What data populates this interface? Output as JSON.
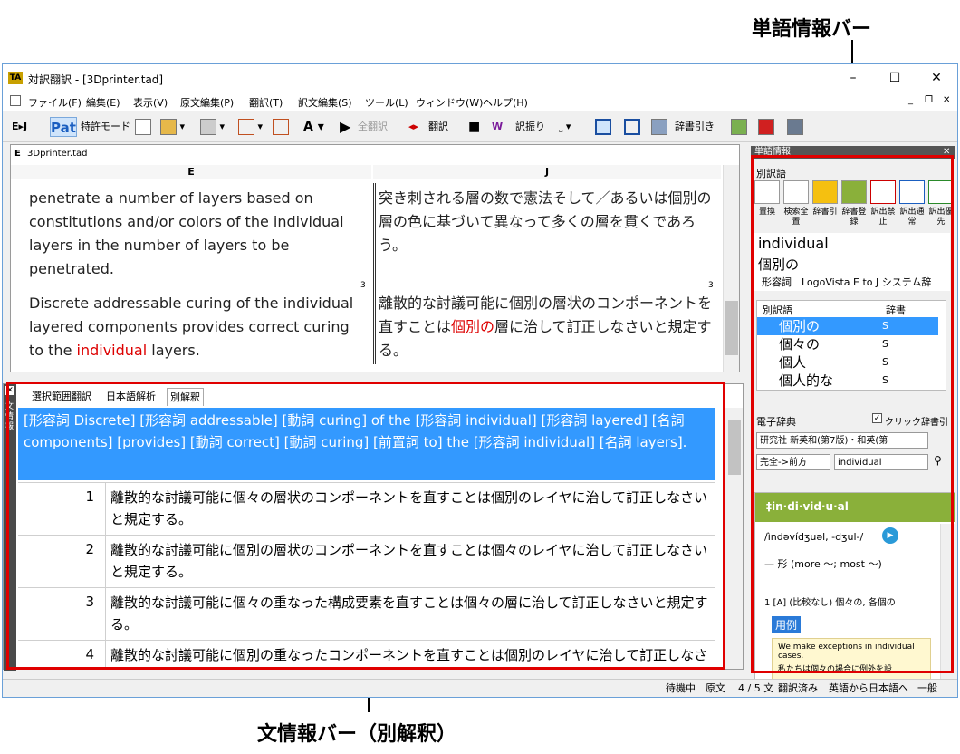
{
  "annotations": {
    "word_info_bar": "単語情報バー",
    "sentence_info_bar": "文情報バー（別解釈）"
  },
  "window": {
    "title": "対訳翻訳 - [3Dprinter.tad]",
    "minimize": "–",
    "maximize": "☐",
    "close": "✕"
  },
  "menu": [
    "ファイル(F)",
    "編集(E)",
    "表示(V)",
    "原文編集(P)",
    "翻訳(T)",
    "訳文編集(S)",
    "ツール(L)",
    "ウィンドウ(W)",
    "ヘルプ(H)"
  ],
  "toolbar": {
    "ej": "E▸J",
    "pat": "Pat",
    "patent_mode": "特許モード",
    "translate_all": "全翻訳",
    "translate": "翻訳",
    "assign": "訳振り",
    "dict_lookup": "辞書引き"
  },
  "document": {
    "tab": "3Dprinter.tad",
    "tab_prefix": "E",
    "col_e": "E",
    "col_j": "J",
    "row1_en": "penetrate a number of layers based on constitutions and/or colors of the individual layers in the number of layers to be penetrated.",
    "row1_ja": "突き刺される層の数で憲法そして／あるいは個別の層の色に基づいて異なって多くの層を貫くであろう。",
    "row_marker": "3",
    "row2_en_a": "Discrete addressable curing of the individual layered components provides correct curing to the ",
    "row2_en_red": "individual",
    "row2_en_b": " layers.",
    "row2_ja_a": "離散的な討議可能に個別の層状のコンポーネントを直すことは",
    "row2_ja_red": "個別の",
    "row2_ja_b": "層に治して訂正しなさいと規定する。"
  },
  "info_panel": {
    "sidebar_label": "文情報",
    "tabs": [
      "選択範囲翻訳",
      "日本語解析",
      "別解釈"
    ],
    "analysis": "[形容詞 Discrete] [形容詞 addressable] [動詞 curing] of the [形容詞 individual] [形容詞 layered] [名詞 components] [provides] [動詞 correct] [動詞 curing] [前置詞 to] the [形容詞 individual] [名詞 layers].",
    "rows": [
      {
        "num": "1",
        "text": "離散的な討議可能に個々の層状のコンポーネントを直すことは個別のレイヤに治して訂正しなさいと規定する。"
      },
      {
        "num": "2",
        "text": "離散的な討議可能に個別の層状のコンポーネントを直すことは個々のレイヤに治して訂正しなさいと規定する。"
      },
      {
        "num": "3",
        "text": "離散的な討議可能に個々の重なった構成要素を直すことは個々の層に治して訂正しなさいと規定する。"
      },
      {
        "num": "4",
        "text": "離散的な討議可能に個別の重なったコンポーネントを直すことは個別のレイヤに治して訂正しなさいと規定する。"
      }
    ]
  },
  "word_panel": {
    "title": "単語情報",
    "section": "別訳語",
    "buttons": [
      "置換",
      "検索全置",
      "辞書引",
      "辞書登録",
      "訳出禁止",
      "訳出通常",
      "訳出優先"
    ],
    "word_en": "individual",
    "word_ja": "個別の",
    "pos": "形容詞",
    "dict_name": "LogoVista E to J システム辞",
    "list_header_word": "別訳語",
    "list_header_dict": "辞書",
    "list": [
      {
        "word": "個別の",
        "dict": "S"
      },
      {
        "word": "個々の",
        "dict": "S"
      },
      {
        "word": "個人",
        "dict": "S"
      },
      {
        "word": "個人的な",
        "dict": "S"
      }
    ],
    "edict": {
      "label": "電子辞典",
      "click_label": "クリック辞書引",
      "dict_select": "研究社 新英和(第7版)・和英(第",
      "mode_select": "完全->前方",
      "query": "individual",
      "headword": "‡in·di·vid·u·al",
      "pron": "/ìndəvídʒuəl, -dʒul-/",
      "pos_line": "— 形 (more ～; most ～)",
      "sense": "1 [A] (比較なし) 個々の, 各個の",
      "example_tag": "用例",
      "example_en": "We make exceptions in individual cases.",
      "example_ja": "私たちは個々の場合に例外を設"
    }
  },
  "status": [
    "待機中",
    "原文",
    "4 / 5 文",
    "翻訳済み",
    "英語から日本語へ",
    "一般"
  ],
  "colors": {
    "accent": "#3399ff",
    "annotation": "#e00000",
    "translated_red": "#d00000",
    "dict_green": "#8ab03a"
  }
}
